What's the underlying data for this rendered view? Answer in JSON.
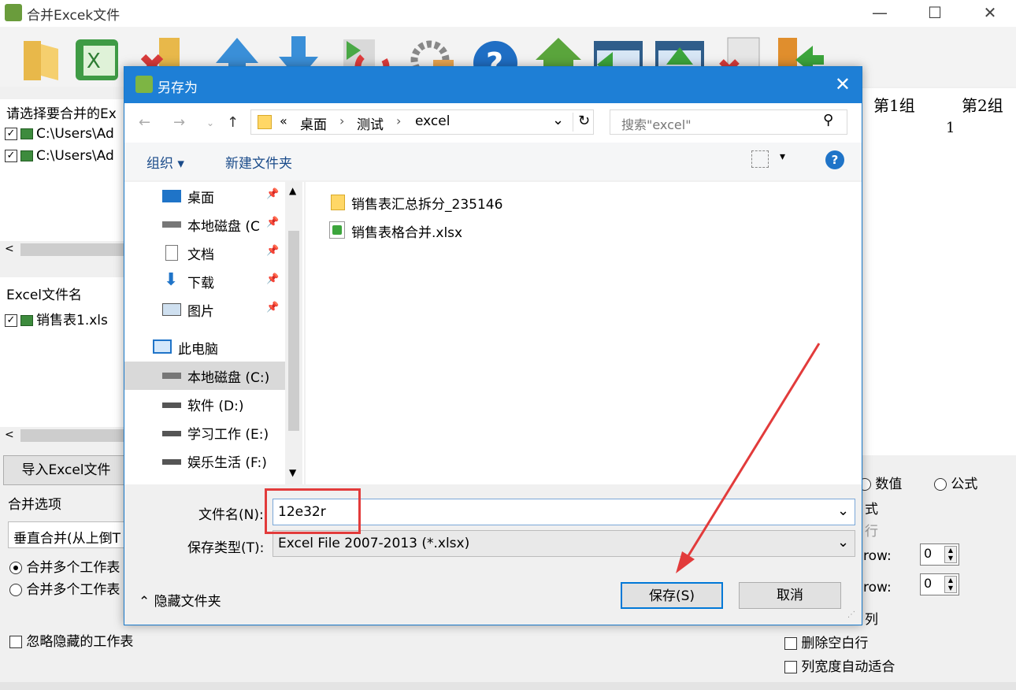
{
  "app": {
    "title": "合并Excek文件",
    "min": "—",
    "max": "☐",
    "close": "✕"
  },
  "toolbar": {
    "icons": [
      "open-folder-icon",
      "excel-icon",
      "delete-icon",
      "move-up-icon",
      "move-down-icon",
      "refresh-icon",
      "settings-icon",
      "help-icon",
      "home-icon",
      "list-left-icon",
      "list-up-icon",
      "remove-file-icon",
      "exit-icon"
    ]
  },
  "left_panel": {
    "header": "请选择要合并的Ex",
    "files": [
      {
        "checked": true,
        "path": "C:\\Users\\Ad"
      },
      {
        "checked": true,
        "path": "C:\\Users\\Ad"
      }
    ],
    "scroll_left": "<",
    "col_header": "Excel文件名",
    "sheets": [
      {
        "checked": true,
        "name": "销售表1.xls"
      }
    ],
    "import_button": "导入Excel文件",
    "merge_options_label": "合并选项",
    "merge_mode": "垂直合并(从上倒T",
    "radio1": "合并多个工作表",
    "radio2": "合并多个工作表",
    "ignore_hidden": "忽略隐藏的工作表"
  },
  "right_panel": {
    "group1": "第1组",
    "group2": "第2组",
    "group2_value": "1",
    "radio_value": "数值",
    "radio_formula": "公式",
    "style_label": "式",
    "row_label": "行",
    "row1_label": "row:",
    "row1_value": "0",
    "row2_label": "row:",
    "row2_value": "0",
    "col_label": "列",
    "delete_blank": "删除空白行",
    "autofit": "列宽度自动适合"
  },
  "dialog": {
    "title": "另存为",
    "close": "✕",
    "breadcrumb": [
      "«",
      "桌面",
      "›",
      "测试",
      "›",
      "excel"
    ],
    "search_placeholder": "搜索\"excel\"",
    "organize": "组织 ▾",
    "new_folder": "新建文件夹",
    "help": "?",
    "quick_access": [
      {
        "icon": "desktop-icon",
        "label": "桌面"
      },
      {
        "icon": "drive-icon",
        "label": "本地磁盘 (C"
      },
      {
        "icon": "document-icon",
        "label": "文档"
      },
      {
        "icon": "download-icon",
        "label": "下载"
      },
      {
        "icon": "picture-icon",
        "label": "图片"
      }
    ],
    "this_pc": "此电脑",
    "drives": [
      {
        "label": "本地磁盘 (C:)",
        "selected": true
      },
      {
        "label": "软件 (D:)",
        "selected": false
      },
      {
        "label": "学习工作 (E:)",
        "selected": false
      },
      {
        "label": "娱乐生活 (F:)",
        "selected": false
      }
    ],
    "files": [
      {
        "type": "folder",
        "name": "销售表汇总拆分_235146"
      },
      {
        "type": "xlsx",
        "name": "销售表格合并.xlsx"
      }
    ],
    "filename_label": "文件名(N):",
    "filename_value": "12e32r",
    "filetype_label": "保存类型(T):",
    "filetype_value": "Excel File 2007-2013 (*.xlsx)",
    "hide_folders": "隐藏文件夹",
    "save": "保存(S)",
    "cancel": "取消"
  },
  "colors": {
    "dialog_title": "#1e7fd6",
    "annotation": "#e23b3b",
    "selection": "#cce4f7"
  }
}
